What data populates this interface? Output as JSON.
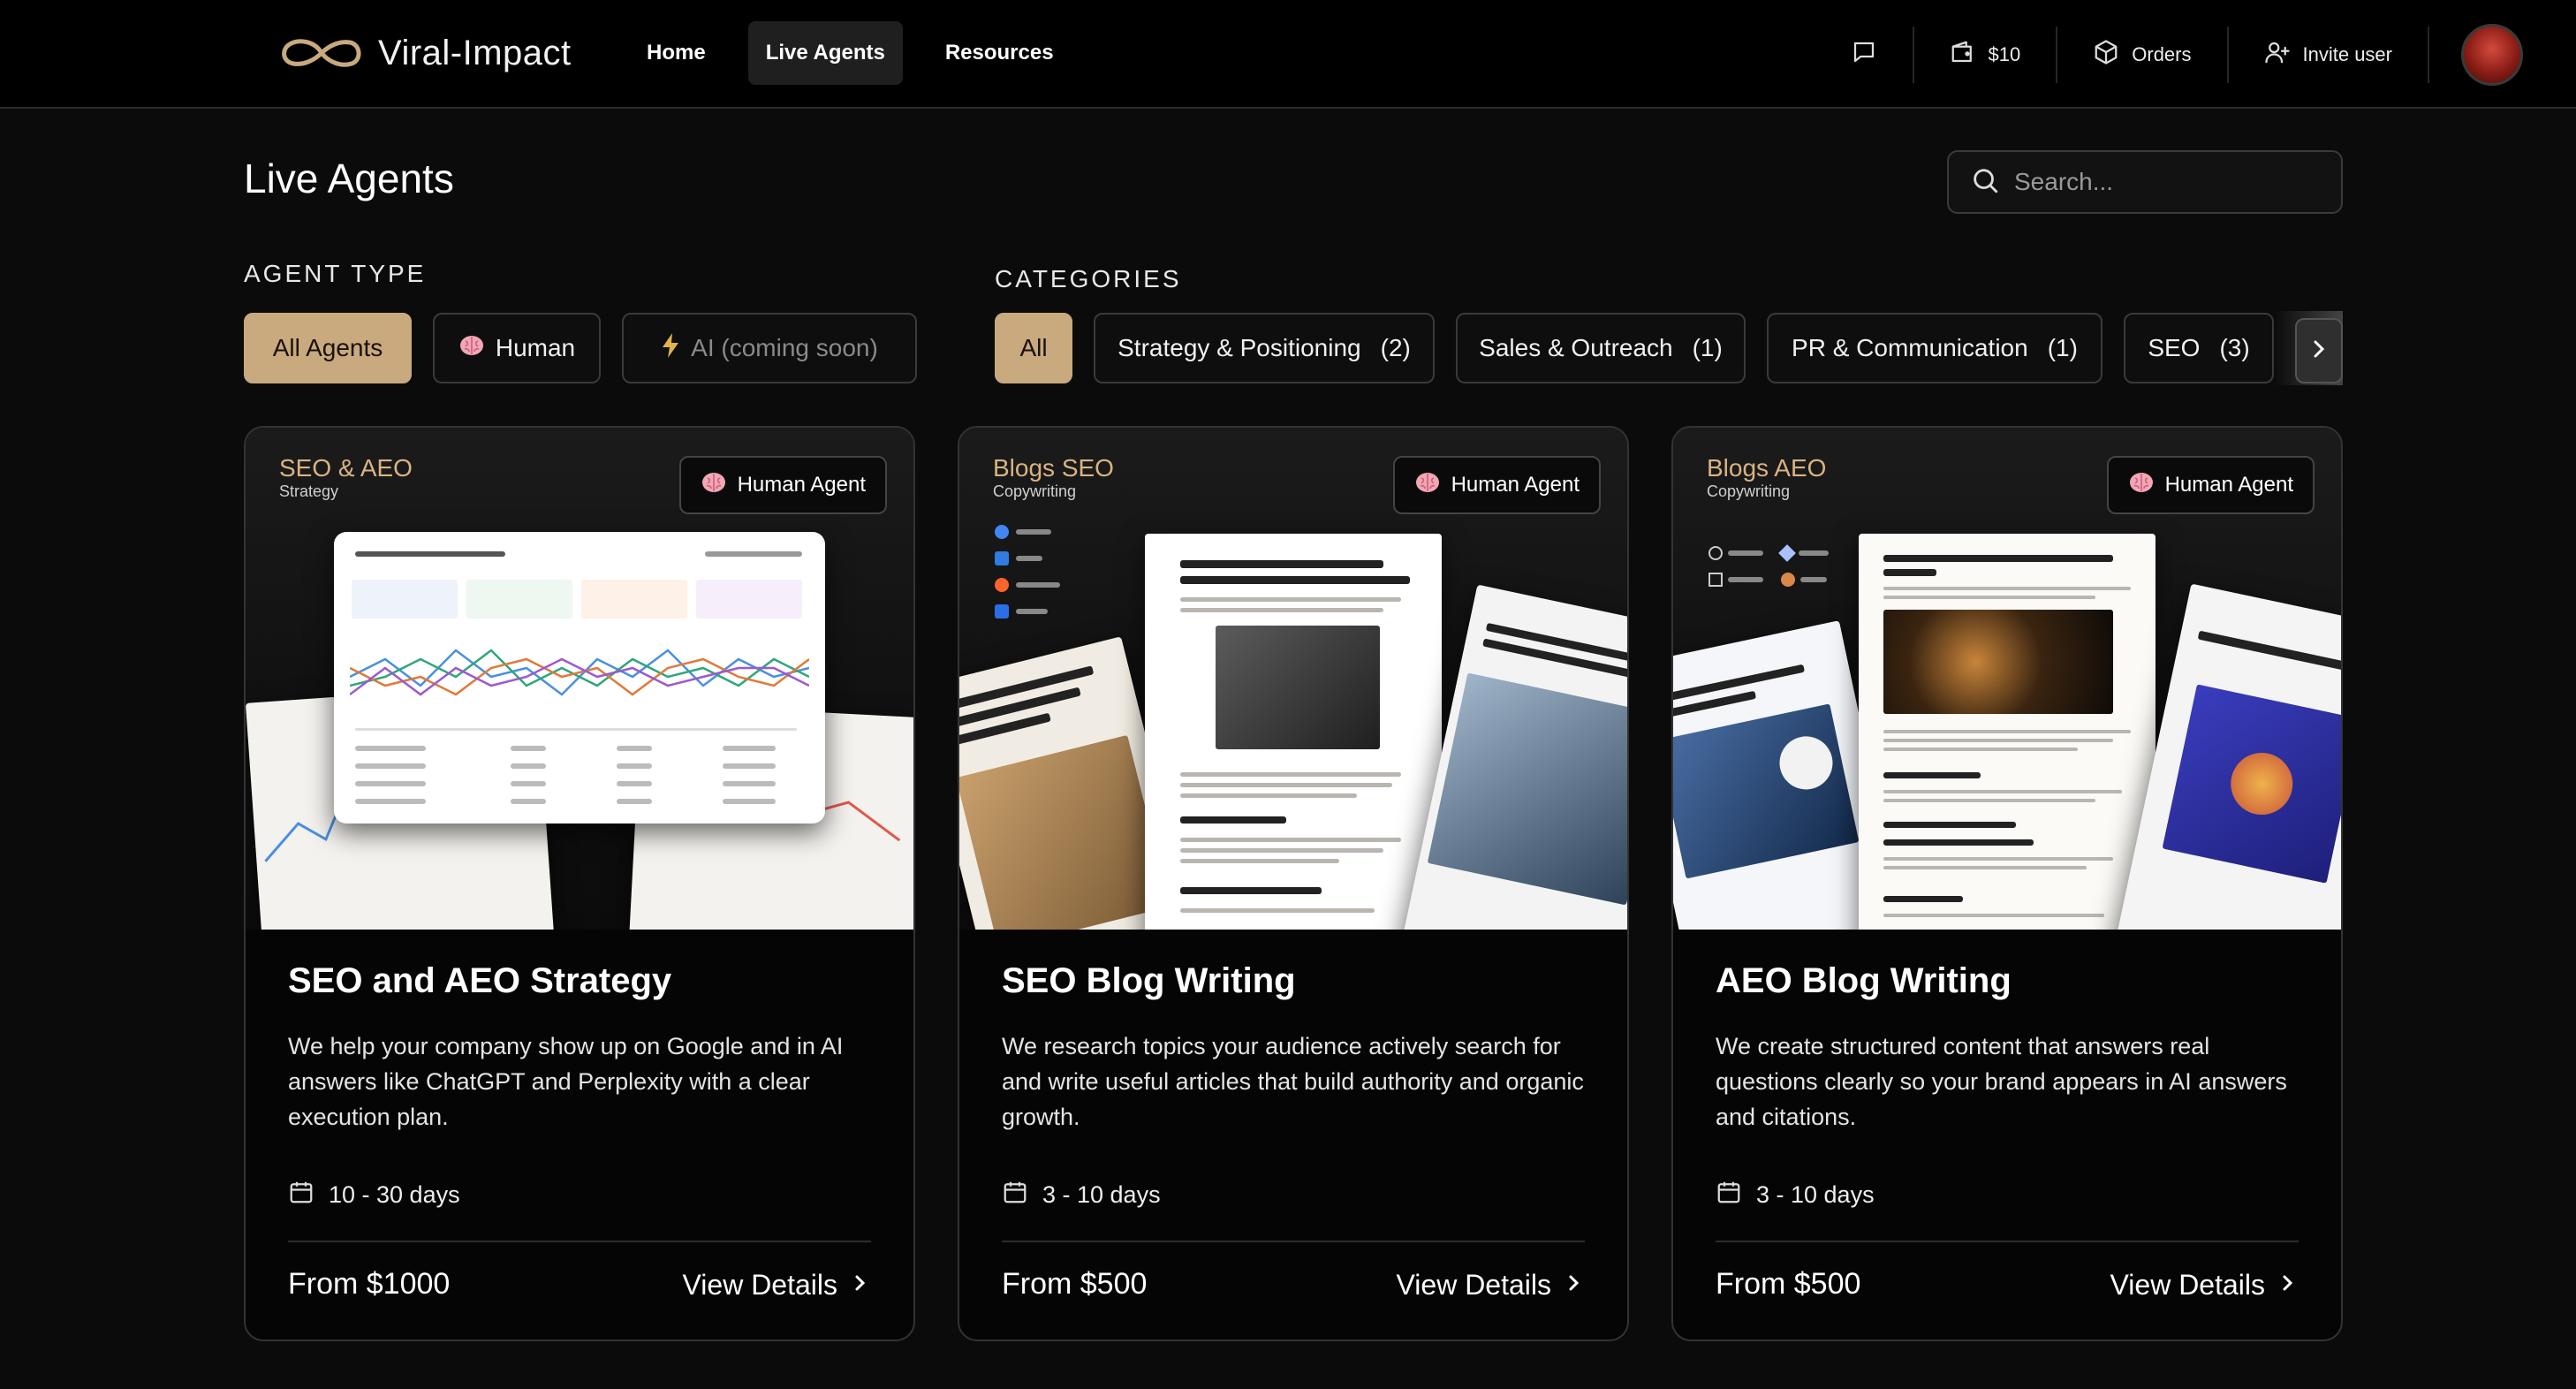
{
  "brand": {
    "name": "Viral-Impact",
    "accent": "#c9a97e"
  },
  "nav": [
    {
      "label": "Home",
      "active": false
    },
    {
      "label": "Live Agents",
      "active": true
    },
    {
      "label": "Resources",
      "active": false
    }
  ],
  "right_nav": {
    "chat_icon": "chat-icon",
    "wallet": {
      "icon": "wallet-icon",
      "label": "$10"
    },
    "orders": {
      "icon": "package-icon",
      "label": "Orders"
    },
    "invite": {
      "icon": "user-plus-icon",
      "label": "Invite user"
    }
  },
  "page": {
    "title": "Live Agents",
    "search_placeholder": "Search..."
  },
  "agent_type": {
    "label": "AGENT TYPE",
    "chips": [
      {
        "label": "All Agents",
        "active": true
      },
      {
        "label": "Human",
        "icon": "brain-icon"
      },
      {
        "label": "AI (coming soon)",
        "icon": "lightning-icon",
        "disabled": true
      }
    ]
  },
  "categories": {
    "label": "CATEGORIES",
    "chips": [
      {
        "label": "All",
        "active": true
      },
      {
        "label": "Strategy & Positioning",
        "count": "(2)"
      },
      {
        "label": "Sales & Outreach",
        "count": "(1)"
      },
      {
        "label": "PR & Communication",
        "count": "(1)"
      },
      {
        "label": "SEO",
        "count": "(3)"
      }
    ]
  },
  "cards": [
    {
      "thumb_title": "SEO & AEO",
      "thumb_sub": "Strategy",
      "badge": "Human Agent",
      "title": "SEO and AEO Strategy",
      "desc": "We help your company show up on Google and in AI answers like ChatGPT and Perplexity with a clear execution plan.",
      "days": "10 - 30 days",
      "price": "From $1000",
      "link": "View Details"
    },
    {
      "thumb_title": "Blogs SEO",
      "thumb_sub": "Copywriting",
      "badge": "Human Agent",
      "title": "SEO Blog Writing",
      "desc": "We research topics your audience actively search for and write useful articles that build authority and organic growth.",
      "days": "3 - 10 days",
      "price": "From $500",
      "link": "View Details"
    },
    {
      "thumb_title": "Blogs AEO",
      "thumb_sub": "Copywriting",
      "badge": "Human Agent",
      "title": "AEO Blog Writing",
      "desc": "We create structured content that answers real questions clearly so your brand appears in AI answers and citations.",
      "days": "3 - 10 days",
      "price": "From $500",
      "link": "View Details"
    }
  ]
}
